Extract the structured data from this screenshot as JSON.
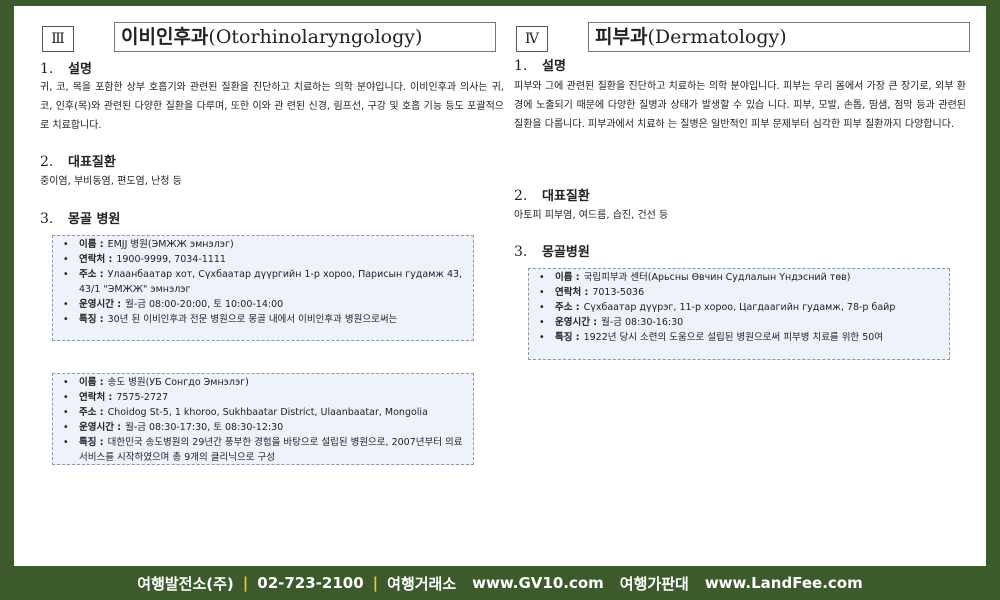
{
  "left": {
    "roman": "Ⅲ",
    "title_ko": "이비인후과",
    "title_en": "(Otorhinolaryngology)",
    "sections": [
      {
        "num": "1.",
        "heading": "설명",
        "text": "귀, 코, 목을 포함한 상부 호흡기와 관련된 질환을 진단하고 치료하는 의학 분야입니다. 이비인후과 의사는 귀, 코, 인후(목)와 관련된 다양한 질환을 다루며, 또한 이와 관 련된 신경, 림프선, 구강 및 호흡 기능 등도 포괄적으로 치료합니다."
      },
      {
        "num": "2.",
        "heading": "대표질환",
        "text": "중이염, 부비동염, 편도염, 난청 등"
      },
      {
        "num": "3.",
        "heading": "몽골 병원"
      }
    ],
    "hospitals": [
      [
        {
          "label": "이름 :",
          "value": "EMJJ 병원(ЭМЖЖ эмнэлэг)"
        },
        {
          "label": "연락처 :",
          "value": "1900-9999, 7034-1111"
        },
        {
          "label": "주소 :",
          "value": "Улаанбаатар хот, Сүхбаатар дүүргийн 1-р хороо,    Парисын гудамж 43, 43/1 \"ЭМЖЖ\" эмнэлэг"
        },
        {
          "label": "운영시간 :",
          "value": "월-금 08:00-20:00, 토 10:00-14:00"
        },
        {
          "label": "특징 :",
          "value": "30년 된 이비인후과 전문 병원으로 몽골 내에서 이비인후과 병원으로써는"
        }
      ],
      [
        {
          "label": "이름 :",
          "value": "송도 병원(УБ Сонгдо Эмнэлэг)"
        },
        {
          "label": "연락처 :",
          "value": "7575-2727"
        },
        {
          "label": "주소 :",
          "value": "Choidog St-5, 1 khoroo, Sukhbaatar District, Ulaanbaatar, Mongolia"
        },
        {
          "label": "운영시간 :",
          "value": "월-금 08:30-17:30, 토 08:30-12:30"
        },
        {
          "label": "특징 :",
          "value": "대한민국 송도병원의 29년간 풍부한 경험을 바탕으로 설립된 병원으로, 2007년부터 의료서비스를 시작하였으며 총 9개의 클리닉으로 구성"
        }
      ]
    ]
  },
  "right": {
    "roman": "Ⅳ",
    "title_ko": "피부과",
    "title_en": "(Dermatology)",
    "sections": [
      {
        "num": "1.",
        "heading": "설명",
        "text": "피부와 그에 관련된 질환을 진단하고 치료하는 의학 분야입니다. 피부는 우리 몸에서 가장 큰 장기로, 외부 환경에 노출되기 때문에 다양한 질병과 상태가 발생할 수 있습 니다. 피부, 모발, 손톱, 땀샘, 점막 등과 관련된 질환을 다룹니다. 피부과에서 치료하 는 질병은 일반적인 피부 문제부터 심각한 피부 질환까지 다양합니다."
      },
      {
        "num": "2.",
        "heading": "대표질환",
        "text": "아토피 피부염, 여드름, 습진, 건선 등"
      },
      {
        "num": "3.",
        "heading": "몽골병원"
      }
    ],
    "hospitals": [
      [
        {
          "label": "이름 :",
          "value": "국립피부과 센터(Арьсны Өвчин Судлалын Үндэсний төв)"
        },
        {
          "label": "연락처 :",
          "value": "7013-5036"
        },
        {
          "label": "주소 :",
          "value": "Сүхбаатар дүүрэг, 11-р хороо, Цагдаагийн гудамж, 78-р байр"
        },
        {
          "label": "운영시간 :",
          "value": "월-금 08:30-16:30"
        },
        {
          "label": "특징 :",
          "value": "1922년 당시 소련의 도움으로 설립된 병원으로써 피부병 치료를 위한 50여"
        }
      ]
    ]
  },
  "footer": {
    "company": "여행발전소(주)",
    "phone": "02-723-2100",
    "label1": "여행거래소",
    "url1": "www.GV10.com",
    "label2": "여행가판대",
    "url2": "www.LandFee.com"
  }
}
